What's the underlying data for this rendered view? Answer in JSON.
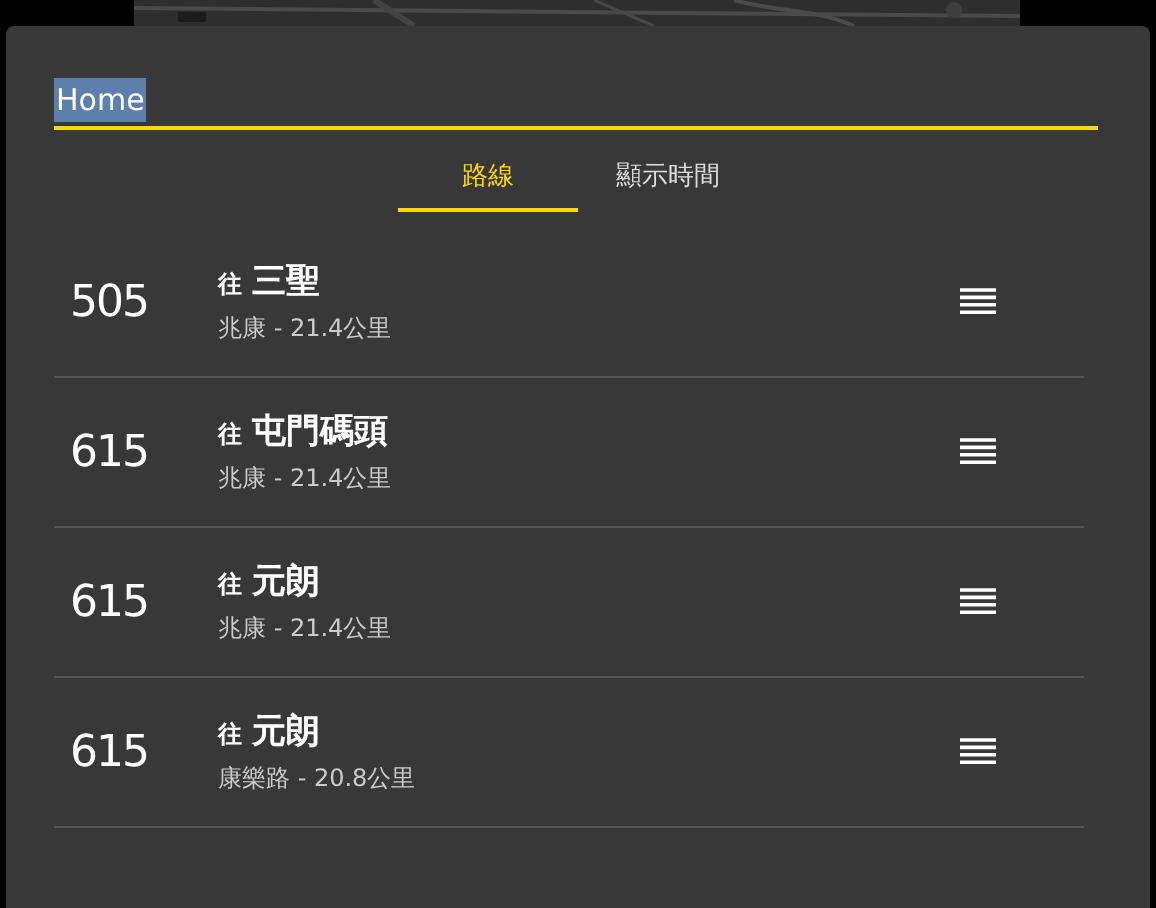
{
  "field": {
    "value": "Home",
    "highlighted": true
  },
  "tabs": [
    {
      "label": "路線",
      "selected": true
    },
    {
      "label": "顯示時間",
      "selected": false
    }
  ],
  "routes": [
    {
      "number": "505",
      "prefix": "往",
      "destination": "三聖",
      "detail": "兆康 - 21.4公里"
    },
    {
      "number": "615",
      "prefix": "往",
      "destination": "屯門碼頭",
      "detail": "兆康 - 21.4公里"
    },
    {
      "number": "615",
      "prefix": "往",
      "destination": "元朗",
      "detail": "兆康 - 21.4公里"
    },
    {
      "number": "615",
      "prefix": "往",
      "destination": "元朗",
      "detail": "康樂路 - 20.8公里"
    }
  ]
}
